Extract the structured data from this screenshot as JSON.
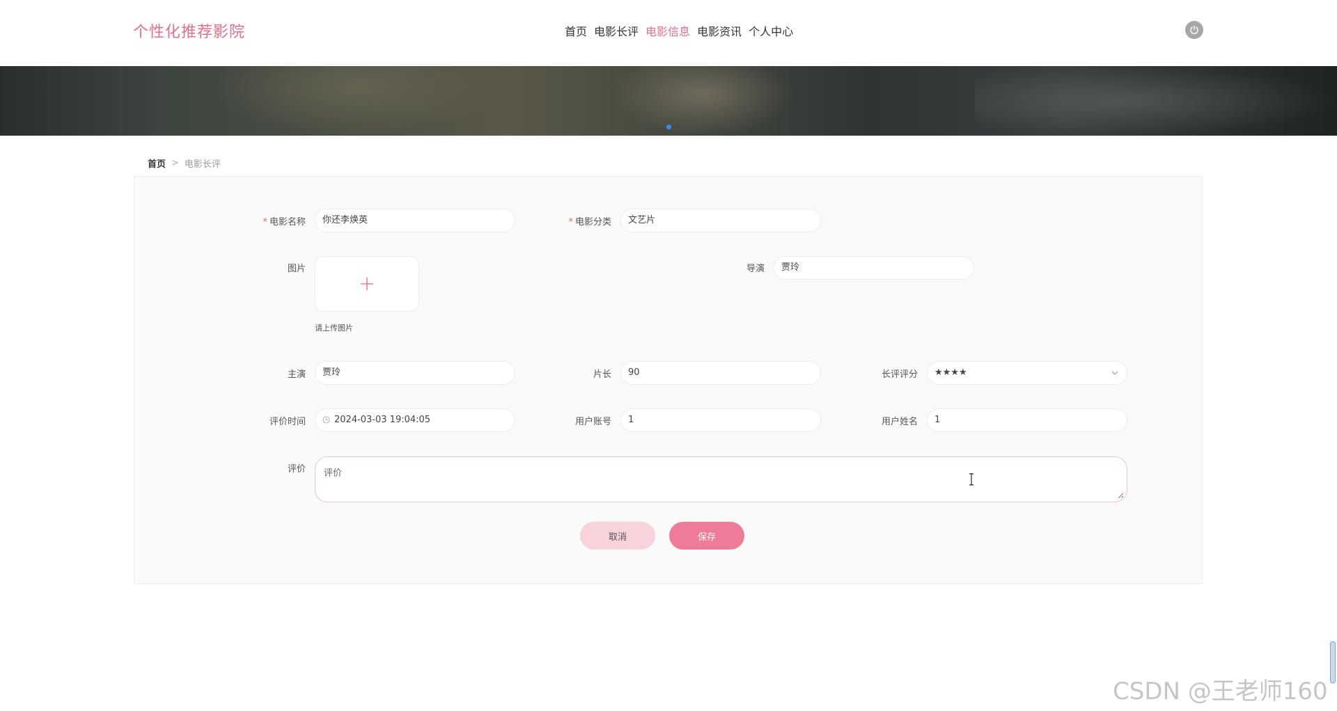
{
  "header": {
    "logo": "个性化推荐影院",
    "nav": [
      "首页",
      "电影长评",
      "电影信息",
      "电影资讯",
      "个人中心"
    ],
    "active_nav": "电影信息",
    "accent_color": "#e36f8d",
    "logout_icon": "power-icon"
  },
  "banner": {
    "carousel_indicator_color": "#2f8ff5"
  },
  "breadcrumb": {
    "home": "首页",
    "separator": ">",
    "current": "电影长评"
  },
  "form": {
    "movie_name": {
      "label": "电影名称",
      "value": "你还李焕英",
      "required": true
    },
    "movie_category": {
      "label": "电影分类",
      "value": "文艺片",
      "required": true
    },
    "image": {
      "label": "图片",
      "hint": "请上传图片",
      "icon": "plus-icon"
    },
    "director": {
      "label": "导演",
      "value": "贾玲"
    },
    "lead_actor": {
      "label": "主演",
      "value": "贾玲"
    },
    "duration": {
      "label": "片长",
      "value": "90"
    },
    "rating": {
      "label": "长评评分",
      "value": "★★★★"
    },
    "review_time": {
      "label": "评价时间",
      "value": "2024-03-03 19:04:05"
    },
    "user_account": {
      "label": "用户账号",
      "value": "1"
    },
    "user_name": {
      "label": "用户姓名",
      "value": "1"
    },
    "review": {
      "label": "评价",
      "placeholder": "评价"
    }
  },
  "buttons": {
    "cancel": "取消",
    "save": "保存"
  },
  "watermark": "CSDN @王老师160"
}
